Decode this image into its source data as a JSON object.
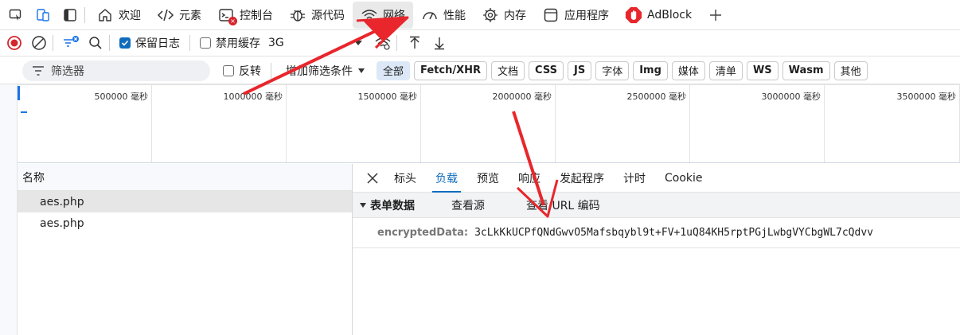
{
  "tabbar": {
    "tabs": [
      {
        "label": "欢迎",
        "icon": "home-icon"
      },
      {
        "label": "元素",
        "icon": "code-brackets-icon"
      },
      {
        "label": "控制台",
        "icon": "console-icon"
      },
      {
        "label": "源代码",
        "icon": "bug-icon"
      },
      {
        "label": "网络",
        "icon": "wifi-icon"
      },
      {
        "label": "性能",
        "icon": "performance-icon"
      },
      {
        "label": "内存",
        "icon": "memory-chip-icon"
      },
      {
        "label": "应用程序",
        "icon": "application-icon"
      },
      {
        "label": "AdBlock",
        "icon": "adblock-icon"
      }
    ],
    "active_tab": "网络",
    "add_icon": "plus-icon"
  },
  "toolbar": {
    "preserve_log_label": "保留日志",
    "preserve_log_checked": true,
    "disable_cache_label": "禁用缓存",
    "disable_cache_checked": false,
    "throttle_value": "3G"
  },
  "filterbar": {
    "filter_placeholder": "筛选器",
    "invert_label": "反转",
    "more_filters_label": "增加筛选条件",
    "chips": [
      "全部",
      "Fetch/XHR",
      "文档",
      "CSS",
      "JS",
      "字体",
      "Img",
      "媒体",
      "清单",
      "WS",
      "Wasm",
      "其他"
    ],
    "active_chip": "全部"
  },
  "timeline": {
    "ticks": [
      "500000 毫秒",
      "1000000 毫秒",
      "1500000 毫秒",
      "2000000 毫秒",
      "2500000 毫秒",
      "3000000 毫秒",
      "3500000 毫秒"
    ]
  },
  "requests": {
    "header": "名称",
    "rows": [
      "aes.php",
      "aes.php"
    ]
  },
  "details": {
    "tabs": [
      "标头",
      "负载",
      "预览",
      "响应",
      "发起程序",
      "计时",
      "Cookie"
    ],
    "active_tab": "负载",
    "section_title": "表单数据",
    "view_source": "查看源",
    "view_url_encoded": "查看 URL 编码",
    "field_key": "encryptedData:",
    "field_value": "3cLkKkUCPfQNdGwvO5Mafsbqybl9t+FV+1uQ84KH5rptPGjLwbgVYCbgWL7cQdvv"
  },
  "colors": {
    "accent": "#0f6cbd",
    "arrow": "#e8262c",
    "active_chip_bg": "#dce8f7"
  }
}
